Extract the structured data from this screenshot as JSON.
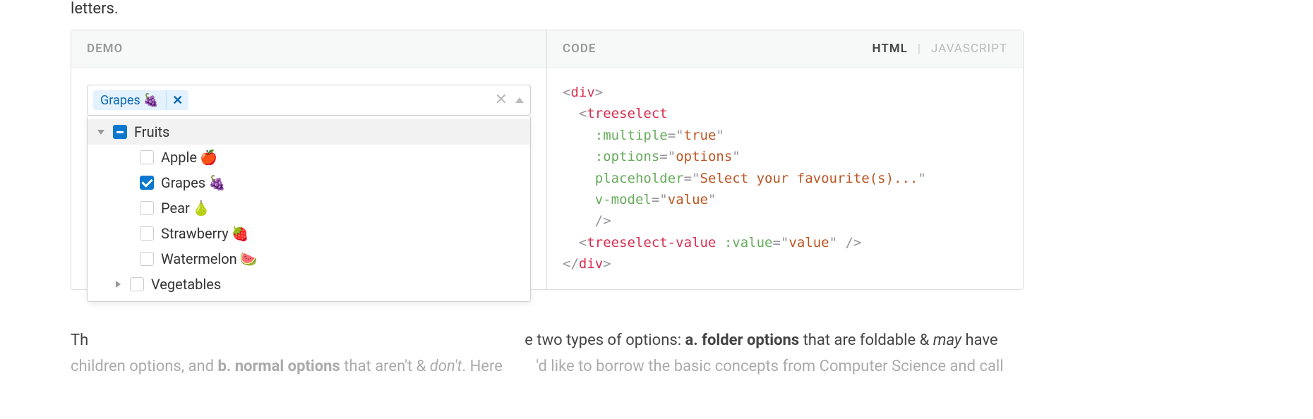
{
  "top_fragment": "letters.",
  "panel": {
    "demo_title": "DEMO",
    "code_title": "CODE",
    "code_tabs": {
      "html": "HTML",
      "javascript": "JAVASCRIPT",
      "active": "HTML"
    }
  },
  "treeselect": {
    "selected_tag": {
      "label": "Grapes",
      "emoji": "🍇"
    },
    "dropdown": [
      {
        "kind": "parent",
        "label": "Fruits",
        "emoji": "",
        "state": "indeterminate",
        "expanded": true
      },
      {
        "kind": "child",
        "label": "Apple",
        "emoji": "🍎",
        "state": "unchecked"
      },
      {
        "kind": "child",
        "label": "Grapes",
        "emoji": "🍇",
        "state": "checked"
      },
      {
        "kind": "child",
        "label": "Pear",
        "emoji": "🍐",
        "state": "unchecked"
      },
      {
        "kind": "child",
        "label": "Strawberry",
        "emoji": "🍓",
        "state": "unchecked"
      },
      {
        "kind": "child",
        "label": "Watermelon",
        "emoji": "🍉",
        "state": "unchecked"
      },
      {
        "kind": "sibling",
        "label": "Vegetables",
        "emoji": "",
        "state": "unchecked",
        "expanded": false
      }
    ]
  },
  "code": {
    "type": "html",
    "lines": [
      {
        "indent": 0,
        "tokens": [
          [
            "cp",
            "<"
          ],
          [
            "ct",
            "div"
          ],
          [
            "cp",
            ">"
          ]
        ]
      },
      {
        "indent": 2,
        "tokens": [
          [
            "cp",
            "<"
          ],
          [
            "ct",
            "treeselect"
          ]
        ]
      },
      {
        "indent": 4,
        "tokens": [
          [
            "ca",
            ":multiple"
          ],
          [
            "cp",
            "="
          ],
          [
            "cp",
            "\""
          ],
          [
            "cv",
            "true"
          ],
          [
            "cp",
            "\""
          ]
        ]
      },
      {
        "indent": 4,
        "tokens": [
          [
            "ca",
            ":options"
          ],
          [
            "cp",
            "="
          ],
          [
            "cp",
            "\""
          ],
          [
            "cv",
            "options"
          ],
          [
            "cp",
            "\""
          ]
        ]
      },
      {
        "indent": 4,
        "tokens": [
          [
            "ca",
            "placeholder"
          ],
          [
            "cp",
            "="
          ],
          [
            "cp",
            "\""
          ],
          [
            "cv",
            "Select your favourite(s)..."
          ],
          [
            "cp",
            "\""
          ]
        ]
      },
      {
        "indent": 4,
        "tokens": [
          [
            "ca",
            "v-model"
          ],
          [
            "cp",
            "="
          ],
          [
            "cp",
            "\""
          ],
          [
            "cv",
            "value"
          ],
          [
            "cp",
            "\""
          ]
        ]
      },
      {
        "indent": 4,
        "tokens": [
          [
            "cp",
            "/>"
          ]
        ]
      },
      {
        "indent": 2,
        "tokens": [
          [
            "cp",
            "<"
          ],
          [
            "ct",
            "treeselect-value"
          ],
          [
            "pl",
            " "
          ],
          [
            "ca",
            ":value"
          ],
          [
            "cp",
            "="
          ],
          [
            "cp",
            "\""
          ],
          [
            "cv",
            "value"
          ],
          [
            "cp",
            "\""
          ],
          [
            "pl",
            " "
          ],
          [
            "cp",
            "/>"
          ]
        ]
      },
      {
        "indent": 0,
        "tokens": [
          [
            "cp",
            "</"
          ],
          [
            "ct",
            "div"
          ],
          [
            "cp",
            ">"
          ]
        ]
      }
    ]
  },
  "body_text": {
    "prefix": "Th",
    "mid1": "e two types of options: ",
    "bold_a": "a. folder options",
    "mid2": " that are foldable & ",
    "italic_may": "may",
    "mid3": " have",
    "line2_prefix": "chi",
    "line2_mid1": "ldren options, and ",
    "bold_b": "b. normal options",
    "line2_mid2": " that aren't & ",
    "italic_dont": "don't",
    "line2_mid3": ". Here ",
    "line2_end": "'d like to borrow the basic concepts from Computer Science and call"
  }
}
